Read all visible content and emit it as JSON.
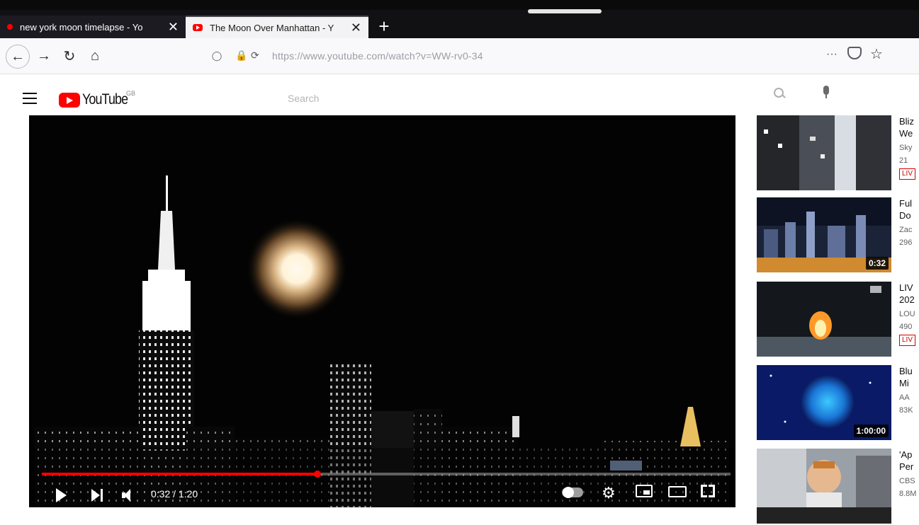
{
  "browser": {
    "tabs": [
      {
        "title": "new york moon timelapse - Yo",
        "active": false
      },
      {
        "title": "The Moon Over Manhattan - Y",
        "active": true
      }
    ],
    "new_tab_label": "+",
    "close_glyph": "✕",
    "url": "https://www.youtube.com/watch?v=WW-rv0-34"
  },
  "youtube": {
    "logo_text": "YouTube",
    "country_code": "GB",
    "search_placeholder": "Search"
  },
  "player": {
    "time_current": "0:32",
    "time_total": "1:20",
    "time_display": "0:32 / 1:20",
    "progress_fraction": 0.4,
    "autoplay_on": false
  },
  "recommendations": [
    {
      "title": "Bliz\nWe",
      "channel": "Sky",
      "views": "21",
      "badge": "LIV",
      "duration": ""
    },
    {
      "title": "Ful\nDo",
      "channel": "Zac",
      "views": "296",
      "badge": "",
      "duration": "0:32"
    },
    {
      "title": "LIV\n202",
      "channel": "LOU",
      "views": "490",
      "badge": "LIV",
      "duration": ""
    },
    {
      "title": "Blu\nMi",
      "channel": "AA",
      "views": "83K",
      "badge": "",
      "duration": "1:00:00"
    },
    {
      "title": "'Ap\nPer",
      "channel": "CBS",
      "views": "8.8M",
      "badge": "",
      "duration": ""
    }
  ],
  "colors": {
    "youtube_red": "#ff0000",
    "tab_strip": "#111113",
    "player_bg": "#030303",
    "moon_glow": "#c9a070"
  }
}
